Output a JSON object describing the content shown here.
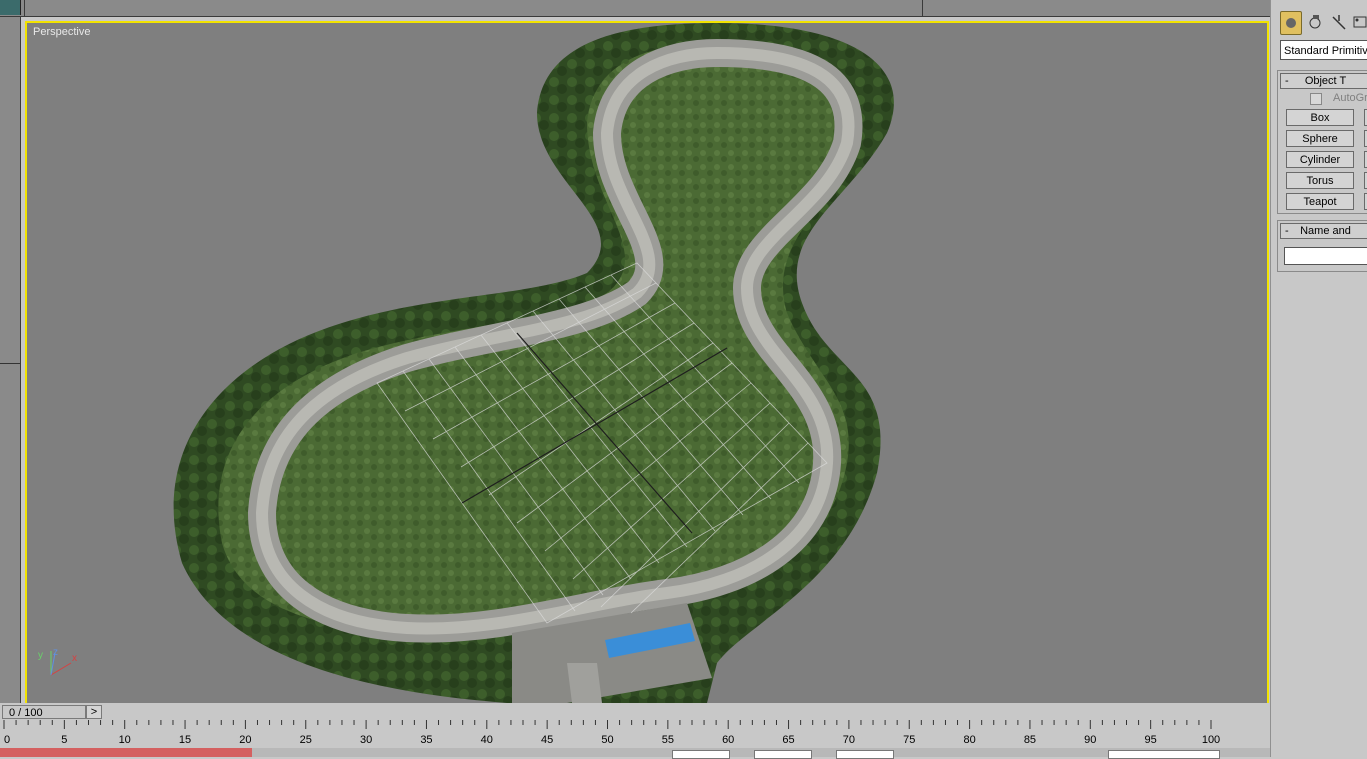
{
  "viewport": {
    "label": "Perspective",
    "axis_labels": {
      "y": "y",
      "z": "z",
      "x": "x"
    },
    "border_color": "#f2e300",
    "background_color": "#7f7f7f"
  },
  "command_panel": {
    "tabs": [
      {
        "name": "create-tab",
        "icon": "sphere-icon"
      },
      {
        "name": "modify-tab",
        "icon": "modify-icon"
      },
      {
        "name": "hierarchy-tab",
        "icon": "hierarchy-icon"
      },
      {
        "name": "motion-tab",
        "icon": "motion-icon"
      }
    ],
    "category_select": "Standard Primitive",
    "object_type": {
      "header": "Object T",
      "collapse": "-",
      "autogrid_label": "AutoGr",
      "buttons": [
        "Box",
        "Sphere",
        "Cylinder",
        "Torus",
        "Teapot"
      ]
    },
    "name_and_color": {
      "header": "Name and",
      "collapse": "-",
      "name_value": ""
    }
  },
  "timeline": {
    "frame_display": "0 / 100",
    "next_button": ">",
    "ticks": [
      "0",
      "5",
      "10",
      "15",
      "20",
      "25",
      "30",
      "35",
      "40",
      "45",
      "50",
      "55",
      "60",
      "65",
      "70",
      "75",
      "80",
      "85",
      "90",
      "95",
      "100"
    ]
  }
}
